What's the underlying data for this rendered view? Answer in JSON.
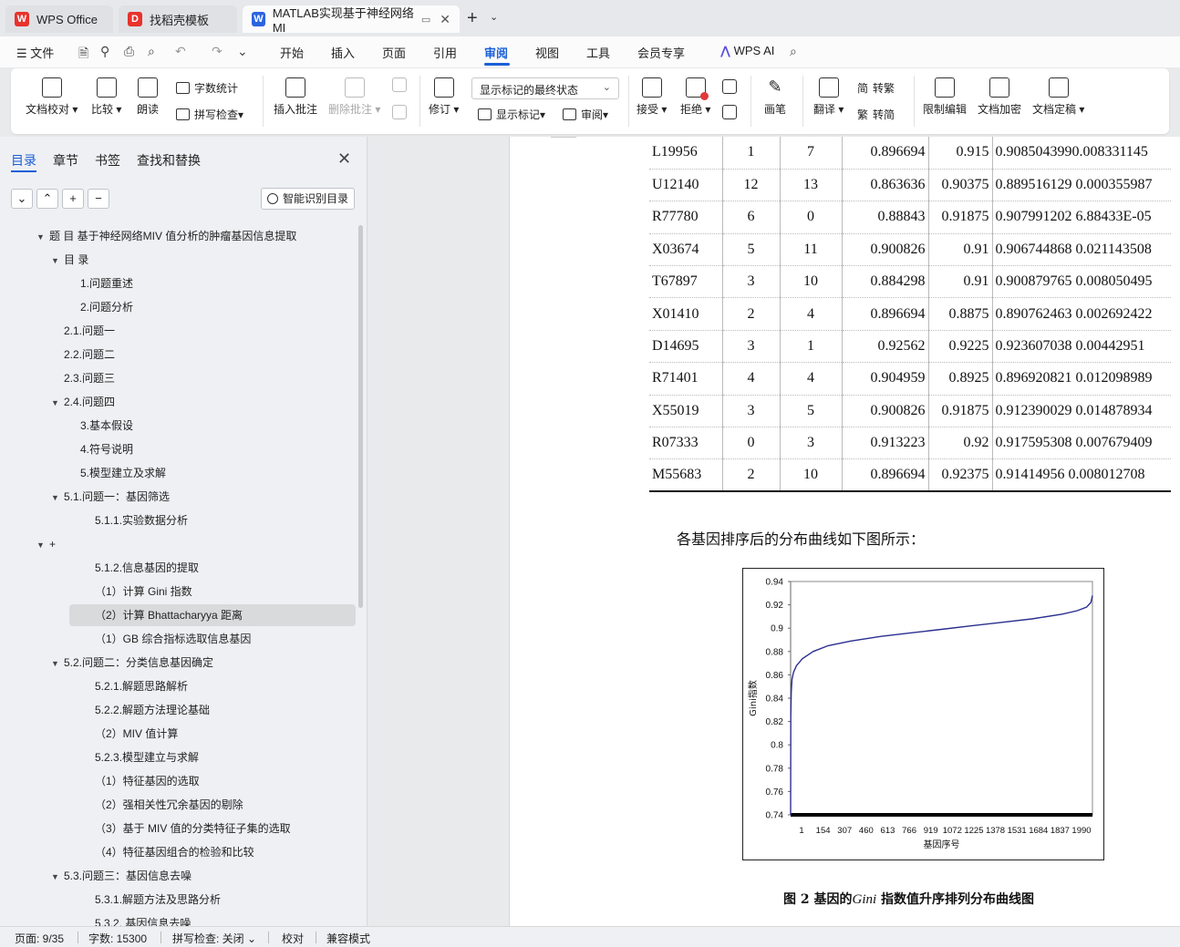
{
  "tabs": [
    {
      "label": "WPS Office",
      "icon": "wps-logo-icon",
      "color": "#e8322c"
    },
    {
      "label": "找稻壳模板",
      "icon": "docer-logo-icon",
      "color": "#e8322c"
    },
    {
      "label": "MATLAB实现基于神经网络MI",
      "icon": "word-doc-icon",
      "color": "#2b64e0"
    }
  ],
  "menu": {
    "file": "文件",
    "items": [
      "开始",
      "插入",
      "页面",
      "引用",
      "审阅",
      "视图",
      "工具",
      "会员专享"
    ],
    "active": "审阅",
    "wps_ai": "WPS AI"
  },
  "ribbon": {
    "doc_check": "文档校对",
    "compare": "比较",
    "read_aloud": "朗读",
    "word_count": "字数统计",
    "spell_check": "拼写检查",
    "insert_comment": "插入批注",
    "delete_comment": "删除批注",
    "revise": "修订",
    "markup_state": "显示标记的最终状态",
    "show_markup": "显示标记",
    "review": "审阅",
    "accept": "接受",
    "reject": "拒绝",
    "pen": "画笔",
    "translate": "翻译",
    "to_traditional": "转繁",
    "to_simplified": "转简",
    "simp_glyph": "简",
    "trad_glyph": "繁",
    "restrict_edit": "限制编辑",
    "doc_encrypt": "文档加密",
    "doc_finalize": "文档定稿"
  },
  "panel": {
    "tabs": [
      "目录",
      "章节",
      "书签",
      "查找和替换"
    ],
    "smart_toc": "智能识别目录",
    "toc": [
      {
        "label": "题 目  基于神经网络MIV 值分析的肿瘤基因信息提取",
        "level": 0,
        "expand": true
      },
      {
        "label": "目 录",
        "level": 1,
        "expand": true
      },
      {
        "label": "1.问题重述",
        "level": 2
      },
      {
        "label": "2.问题分析",
        "level": 2
      },
      {
        "label": "2.1.问题一",
        "level": 1
      },
      {
        "label": "2.2.问题二",
        "level": 1
      },
      {
        "label": "2.3.问题三",
        "level": 1
      },
      {
        "label": "2.4.问题四",
        "level": 1,
        "expand": true
      },
      {
        "label": "3.基本假设",
        "level": 2
      },
      {
        "label": "4.符号说明",
        "level": 2
      },
      {
        "label": "5.模型建立及求解",
        "level": 2
      },
      {
        "label": "5.1.问题一：基因筛选",
        "level": 1,
        "expand": true
      },
      {
        "label": "5.1.1.实验数据分析",
        "level": 3
      },
      {
        "label": "+",
        "level": 0,
        "expand": true
      },
      {
        "label": "5.1.2.信息基因的提取",
        "level": 3
      },
      {
        "label": "（1）计算 Gini 指数",
        "level": 3
      },
      {
        "label": "（2）计算 Bhattacharyya 距离",
        "level": 3,
        "selected": true
      },
      {
        "label": "（1）GB 综合指标选取信息基因",
        "level": 3
      },
      {
        "label": "5.2.问题二：分类信息基因确定",
        "level": 1,
        "expand": true
      },
      {
        "label": "5.2.1.解题思路解析",
        "level": 3
      },
      {
        "label": "5.2.2.解题方法理论基础",
        "level": 3
      },
      {
        "label": "（2）MIV 值计算",
        "level": 3
      },
      {
        "label": "5.2.3.模型建立与求解",
        "level": 3
      },
      {
        "label": "（1）特征基因的选取",
        "level": 3
      },
      {
        "label": "（2）强相关性冗余基因的剔除",
        "level": 3
      },
      {
        "label": "（3）基于 MIV 值的分类特征子集的选取",
        "level": 3
      },
      {
        "label": "（4）特征基因组合的检验和比较",
        "level": 3
      },
      {
        "label": "5.3.问题三：基因信息去噪",
        "level": 1,
        "expand": true
      },
      {
        "label": "5.3.1.解题方法及思路分析",
        "level": 3
      },
      {
        "label": "5.3.2. 基因信息去噪",
        "level": 3
      }
    ]
  },
  "doc": {
    "rows": [
      [
        "L19956",
        "1",
        "7",
        "0.896694",
        "0.915",
        "0.9085043990.008331145"
      ],
      [
        "U12140",
        "12",
        "13",
        "0.863636",
        "0.90375",
        "0.889516129 0.000355987"
      ],
      [
        "R77780",
        "6",
        "0",
        "0.88843",
        "0.91875",
        "0.907991202 6.88433E-05"
      ],
      [
        "X03674",
        "5",
        "11",
        "0.900826",
        "0.91",
        "0.906744868 0.021143508"
      ],
      [
        "T67897",
        "3",
        "10",
        "0.884298",
        "0.91",
        "0.900879765 0.008050495"
      ],
      [
        "X01410",
        "2",
        "4",
        "0.896694",
        "0.8875",
        "0.890762463 0.002692422"
      ],
      [
        "D14695",
        "3",
        "1",
        "0.92562",
        "0.9225",
        "0.923607038 0.00442951"
      ],
      [
        "R71401",
        "4",
        "4",
        "0.904959",
        "0.8925",
        "0.896920821 0.012098989"
      ],
      [
        "X55019",
        "3",
        "5",
        "0.900826",
        "0.91875",
        "0.912390029 0.014878934"
      ],
      [
        "R07333",
        "0",
        "3",
        "0.913223",
        "0.92",
        "0.917595308 0.007679409"
      ],
      [
        "M55683",
        "2",
        "10",
        "0.896694",
        "0.92375",
        "0.91414956 0.008012708"
      ]
    ],
    "intro": "各基因排序后的分布曲线如下图所示：",
    "figure_caption_pre": "图 2 基因的",
    "figure_caption_var": "Gini",
    "figure_caption_post": " 指数值升序排列分布曲线图"
  },
  "chart_data": {
    "type": "line",
    "title": "",
    "xlabel": "基因序号",
    "ylabel": "Gini指数",
    "x_ticks": [
      "1",
      "154",
      "307",
      "460",
      "613",
      "766",
      "919",
      "1072",
      "1225",
      "1378",
      "1531",
      "1684",
      "1837",
      "1990"
    ],
    "y_ticks": [
      "0.94",
      "0.92",
      "0.9",
      "0.88",
      "0.86",
      "0.84",
      "0.82",
      "0.8",
      "0.78",
      "0.76",
      "0.74"
    ],
    "ylim": [
      0.74,
      0.94
    ],
    "xlim": [
      1,
      2000
    ],
    "grid": false,
    "line_color": "#2a2f8f",
    "series": [
      {
        "x": [
          1,
          2,
          5,
          10,
          20,
          40,
          80,
          150,
          250,
          400,
          600,
          800,
          1000,
          1200,
          1400,
          1600,
          1800,
          1900,
          1960,
          1990,
          2000
        ],
        "y": [
          0.74,
          0.825,
          0.845,
          0.856,
          0.862,
          0.868,
          0.874,
          0.88,
          0.885,
          0.889,
          0.893,
          0.896,
          0.899,
          0.902,
          0.905,
          0.908,
          0.912,
          0.915,
          0.918,
          0.922,
          0.928
        ]
      }
    ]
  },
  "status": {
    "page": "页面: 9/35",
    "words": "字数: 15300",
    "spell": "拼写检查: 关闭",
    "proof": "校对",
    "compat": "兼容模式"
  }
}
